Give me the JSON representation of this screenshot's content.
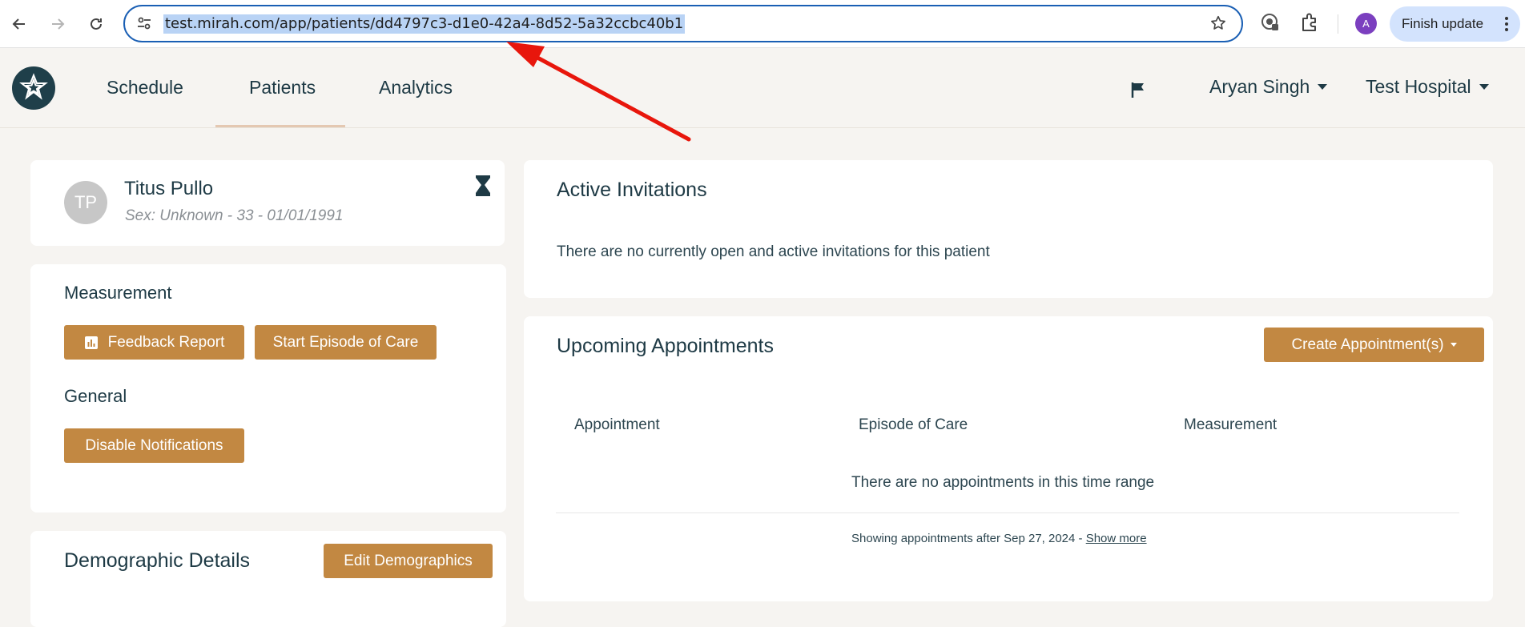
{
  "browser": {
    "url": "test.mirah.com/app/patients/dd4797c3-d1e0-42a4-8d52-5a32ccbc40b1",
    "profile_initial": "A",
    "finish_update_label": "Finish update"
  },
  "nav": {
    "links": [
      "Schedule",
      "Patients",
      "Analytics"
    ],
    "active": "Patients",
    "user": "Aryan Singh",
    "organization": "Test Hospital"
  },
  "patient": {
    "initials": "TP",
    "name": "Titus Pullo",
    "details": "Sex: Unknown - 33 - 01/01/1991"
  },
  "measurement": {
    "heading": "Measurement",
    "feedback_report_label": "Feedback Report",
    "start_episode_label": "Start Episode of Care"
  },
  "general": {
    "heading": "General",
    "disable_notifications_label": "Disable Notifications"
  },
  "demographics": {
    "heading": "Demographic Details",
    "edit_label": "Edit Demographics"
  },
  "invitations": {
    "heading": "Active Invitations",
    "empty_text": "There are no currently open and active invitations for this patient"
  },
  "appointments": {
    "heading": "Upcoming Appointments",
    "create_label": "Create Appointment(s)",
    "columns": [
      "Appointment",
      "Episode of Care",
      "Measurement"
    ],
    "empty_text": "There are no appointments in this time range",
    "footer_text": "Showing appointments after Sep 27, 2024 - ",
    "show_more_label": "Show more"
  },
  "colors": {
    "accent_brown": "#c28842",
    "primary_text": "#1e3a45",
    "annotation_red": "#e8160c",
    "url_selection": "#b9d3f5"
  }
}
